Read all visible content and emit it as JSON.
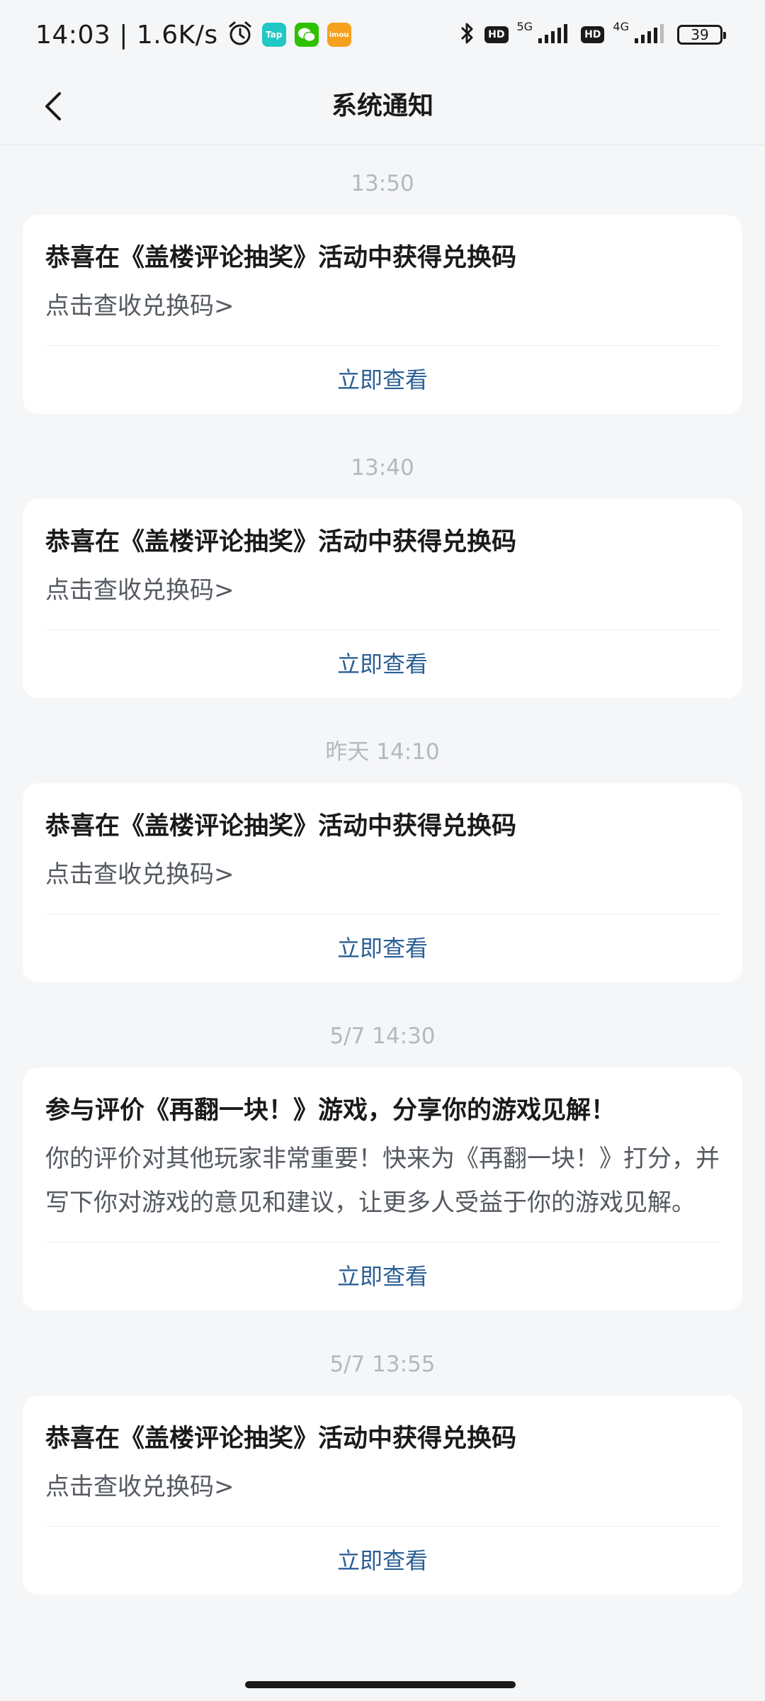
{
  "status_bar": {
    "time": "14:03",
    "separator": "|",
    "speed": "1.6K/s",
    "app1": "Tap",
    "app3": "imou",
    "hd1": "HD",
    "net1": "5G",
    "hd2": "HD",
    "net2": "4G",
    "battery": "39"
  },
  "header": {
    "title": "系统通知"
  },
  "notifications": [
    {
      "time": "13:50",
      "title": "恭喜在《盖楼评论抽奖》活动中获得兑换码",
      "body": "点击查收兑换码>",
      "action": "立即查看"
    },
    {
      "time": "13:40",
      "title": "恭喜在《盖楼评论抽奖》活动中获得兑换码",
      "body": "点击查收兑换码>",
      "action": "立即查看"
    },
    {
      "time": "昨天  14:10",
      "title": "恭喜在《盖楼评论抽奖》活动中获得兑换码",
      "body": "点击查收兑换码>",
      "action": "立即查看"
    },
    {
      "time": "5/7  14:30",
      "title": "参与评价《再翻一块！》游戏，分享你的游戏见解！",
      "body": "你的评价对其他玩家非常重要！快来为《再翻一块！》打分，并写下你对游戏的意见和建议，让更多人受益于你的游戏见解。",
      "action": "立即查看"
    },
    {
      "time": "5/7  13:55",
      "title": "恭喜在《盖楼评论抽奖》活动中获得兑换码",
      "body": "点击查收兑换码>",
      "action": "立即查看"
    }
  ]
}
